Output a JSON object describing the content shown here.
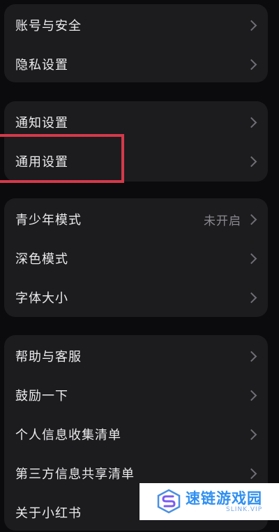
{
  "groups": [
    {
      "items": [
        {
          "label": "账号与安全"
        },
        {
          "label": "隐私设置"
        }
      ]
    },
    {
      "items": [
        {
          "label": "通知设置"
        },
        {
          "label": "通用设置"
        }
      ]
    },
    {
      "items": [
        {
          "label": "青少年模式",
          "value": "未开启"
        },
        {
          "label": "深色模式"
        },
        {
          "label": "字体大小"
        }
      ]
    },
    {
      "items": [
        {
          "label": "帮助与客服"
        },
        {
          "label": "鼓励一下"
        },
        {
          "label": "个人信息收集清单"
        },
        {
          "label": "第三方信息共享清单"
        },
        {
          "label": "关于小红书"
        }
      ]
    }
  ],
  "watermark": {
    "title": "速链游戏园",
    "subtitle": "SLINK.VIP"
  },
  "colors": {
    "background": "#0b0b0d",
    "group": "#1c1c1f",
    "highlight": "#d5394a",
    "watermark_text": "#2f8ff0"
  },
  "icons": {
    "row_arrow": "chevron-right-icon",
    "watermark_logo": "link-s-logo-icon"
  }
}
